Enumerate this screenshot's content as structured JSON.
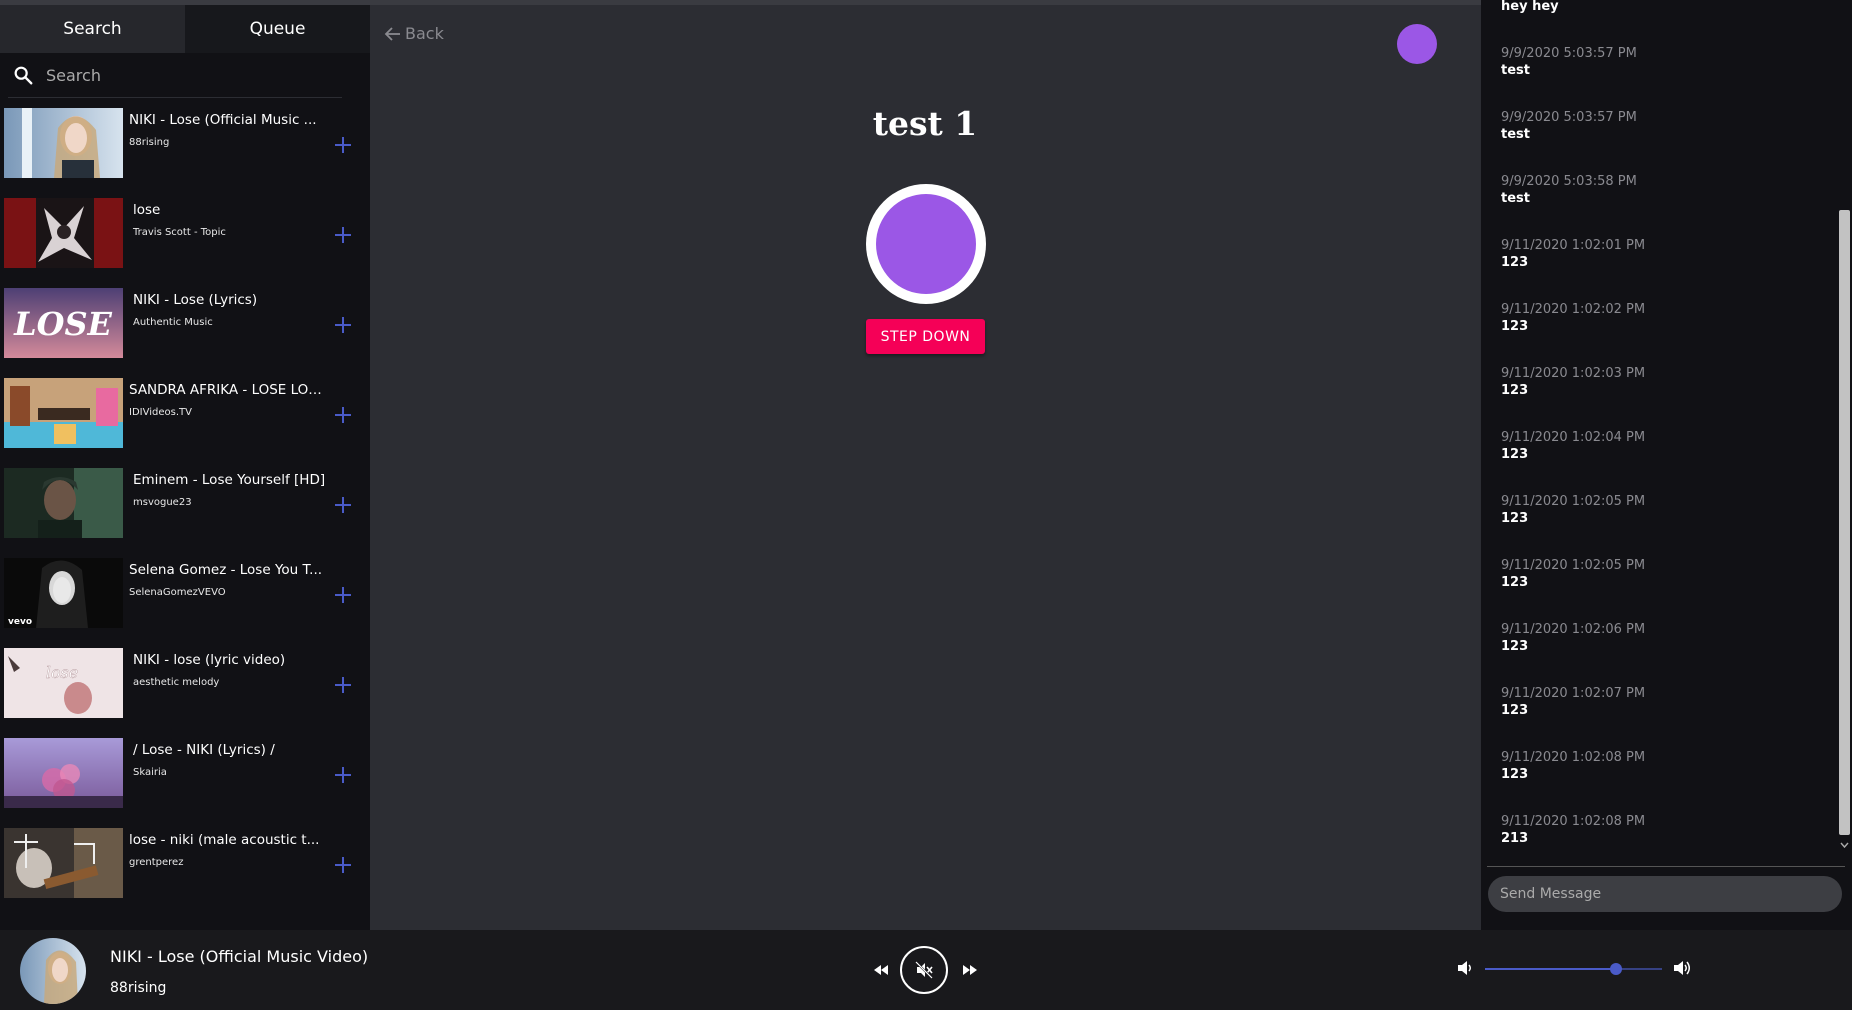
{
  "tabs": [
    {
      "label": "Search",
      "active": true
    },
    {
      "label": "Queue",
      "active": false
    }
  ],
  "search": {
    "placeholder": "Search"
  },
  "results": [
    {
      "title": "NIKI - Lose (Official Music ...",
      "channel": "88rising",
      "thumb": "thumb-girl-blue"
    },
    {
      "title": "lose",
      "channel": "Travis Scott - Topic",
      "thumb": "thumb-red-art"
    },
    {
      "title": "NIKI - Lose (Lyrics)",
      "channel": "Authentic Music",
      "thumb": "thumb-lose-text",
      "thumb_text": "LOSE"
    },
    {
      "title": "SANDRA AFRIKA - LOSE LOS...",
      "channel": "IDIVideos.TV",
      "thumb": "thumb-colorful"
    },
    {
      "title": "Eminem - Lose Yourself [HD]",
      "channel": "msvogue23",
      "thumb": "thumb-green-dark"
    },
    {
      "title": "Selena Gomez - Lose You T...",
      "channel": "SelenaGomezVEVO",
      "thumb": "thumb-bw-portrait",
      "thumb_text": "vevo"
    },
    {
      "title": "NIKI - lose (lyric video)",
      "channel": "aesthetic melody",
      "thumb": "thumb-pink-drawing",
      "thumb_text": "lose"
    },
    {
      "title": "/ Lose - NIKI (Lyrics) /",
      "channel": "Skairia",
      "thumb": "thumb-purple-flowers"
    },
    {
      "title": "lose - niki (male acoustic t...",
      "channel": "grentperez",
      "thumb": "thumb-guitar"
    }
  ],
  "center": {
    "back_label": "Back",
    "room_title": "test 1",
    "step_down_label": "STEP DOWN",
    "avatar_color": "#9b57e6",
    "step_down_color": "#f50057"
  },
  "chat": {
    "messages": [
      {
        "time": "",
        "text": "hey hey"
      },
      {
        "time": "9/9/2020 5:03:57 PM",
        "text": "test"
      },
      {
        "time": "9/9/2020 5:03:57 PM",
        "text": "test"
      },
      {
        "time": "9/9/2020 5:03:58 PM",
        "text": "test"
      },
      {
        "time": "9/11/2020 1:02:01 PM",
        "text": "123"
      },
      {
        "time": "9/11/2020 1:02:02 PM",
        "text": "123"
      },
      {
        "time": "9/11/2020 1:02:03 PM",
        "text": "123"
      },
      {
        "time": "9/11/2020 1:02:04 PM",
        "text": "123"
      },
      {
        "time": "9/11/2020 1:02:05 PM",
        "text": "123"
      },
      {
        "time": "9/11/2020 1:02:05 PM",
        "text": "123"
      },
      {
        "time": "9/11/2020 1:02:06 PM",
        "text": "123"
      },
      {
        "time": "9/11/2020 1:02:07 PM",
        "text": "123"
      },
      {
        "time": "9/11/2020 1:02:08 PM",
        "text": "123"
      },
      {
        "time": "9/11/2020 1:02:08 PM",
        "text": "213"
      }
    ],
    "send_placeholder": "Send Message"
  },
  "player": {
    "title": "NIKI - Lose (Official Music Video)",
    "channel": "88rising",
    "volume": 0.74,
    "accent": "#4a5bc8"
  }
}
